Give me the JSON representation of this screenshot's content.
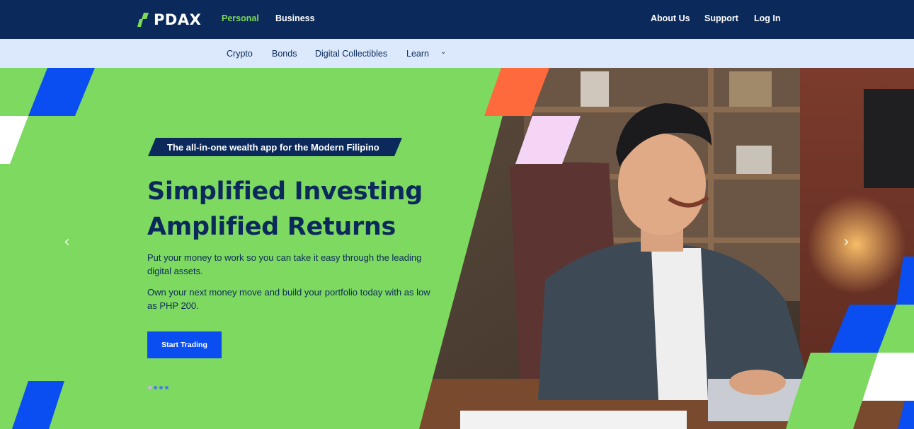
{
  "header": {
    "logo_text": "PDAX",
    "nav_left": [
      "Personal",
      "Business"
    ],
    "nav_right": [
      "About Us",
      "Support",
      "Log In"
    ],
    "active_nav": "Personal"
  },
  "subnav": {
    "items": [
      "Crypto",
      "Bonds",
      "Digital Collectibles",
      "Learn"
    ]
  },
  "hero": {
    "tagline": "The all-in-one wealth app for the Modern Filipino",
    "headline_line1": "Simplified Investing",
    "headline_line2": "Amplified Returns",
    "paragraph1": "Put your money to work so you can take it easy through the leading digital assets.",
    "paragraph2": "Own your next money move and build your portfolio today with as low as PHP 200.",
    "cta_label": "Start Trading",
    "prev_arrow": "‹",
    "next_arrow": "›",
    "slide_count": 4,
    "active_slide": 1
  },
  "colors": {
    "navy": "#0b2a5b",
    "green": "#7ed961",
    "blue": "#0a4ef2",
    "subnav_bg": "#dce8fb",
    "orange": "#ff6a3d",
    "pink": "#f5d5f5"
  }
}
